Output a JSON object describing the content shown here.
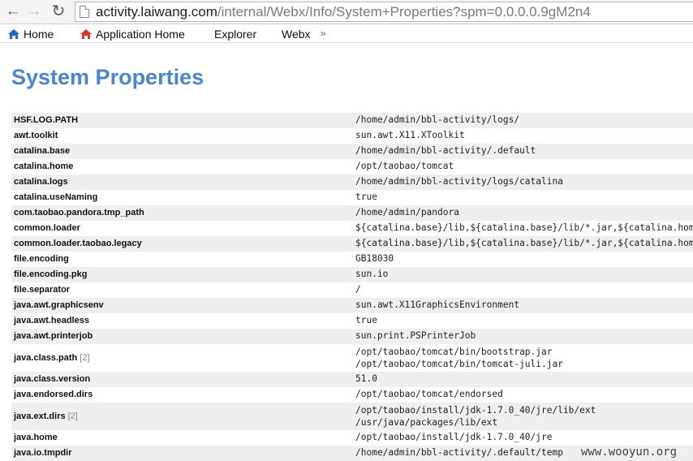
{
  "browser": {
    "url_host": "activity.laiwang.com",
    "url_path": "/internal/Webx/Info/System+Properties?spm=0.0.0.0.9gM2n4"
  },
  "bookmarks": [
    {
      "label": "Home",
      "icon": "home-icon-blue"
    },
    {
      "label": "Application Home",
      "icon": "home-icon-red"
    },
    {
      "label": "Explorer"
    },
    {
      "label": "Webx"
    }
  ],
  "bookmarks_more": "»",
  "page": {
    "title": "System Properties"
  },
  "properties": [
    {
      "key": "HSF.LOG.PATH",
      "values": [
        "/home/admin/bbl-activity/logs/"
      ]
    },
    {
      "key": "awt.toolkit",
      "values": [
        "sun.awt.X11.XToolkit"
      ]
    },
    {
      "key": "catalina.base",
      "values": [
        "/home/admin/bbl-activity/.default"
      ]
    },
    {
      "key": "catalina.home",
      "values": [
        "/opt/taobao/tomcat"
      ]
    },
    {
      "key": "catalina.logs",
      "values": [
        "/home/admin/bbl-activity/logs/catalina"
      ]
    },
    {
      "key": "catalina.useNaming",
      "values": [
        "true"
      ]
    },
    {
      "key": "com.taobao.pandora.tmp_path",
      "values": [
        "/home/admin/pandora"
      ]
    },
    {
      "key": "common.loader",
      "values": [
        "${catalina.base}/lib,${catalina.base}/lib/*.jar,${catalina.home}/lib"
      ]
    },
    {
      "key": "common.loader.taobao.legacy",
      "values": [
        "${catalina.base}/lib,${catalina.base}/lib/*.jar,${catalina.home}/lib"
      ]
    },
    {
      "key": "file.encoding",
      "values": [
        "GB18030"
      ]
    },
    {
      "key": "file.encoding.pkg",
      "values": [
        "sun.io"
      ]
    },
    {
      "key": "file.separator",
      "values": [
        "/"
      ]
    },
    {
      "key": "java.awt.graphicsenv",
      "values": [
        "sun.awt.X11GraphicsEnvironment"
      ]
    },
    {
      "key": "java.awt.headless",
      "values": [
        "true"
      ]
    },
    {
      "key": "java.awt.printerjob",
      "values": [
        "sun.print.PSPrinterJob"
      ]
    },
    {
      "key": "java.class.path",
      "count": "[2]",
      "values": [
        "/opt/taobao/tomcat/bin/bootstrap.jar",
        "/opt/taobao/tomcat/bin/tomcat-juli.jar"
      ]
    },
    {
      "key": "java.class.version",
      "values": [
        "51.0"
      ]
    },
    {
      "key": "java.endorsed.dirs",
      "values": [
        "/opt/taobao/tomcat/endorsed"
      ]
    },
    {
      "key": "java.ext.dirs",
      "count": "[2]",
      "values": [
        "/opt/taobao/install/jdk-1.7.0_40/jre/lib/ext",
        "/usr/java/packages/lib/ext"
      ]
    },
    {
      "key": "java.home",
      "values": [
        "/opt/taobao/install/jdk-1.7.0_40/jre"
      ]
    },
    {
      "key": "java.io.tmpdir",
      "values": [
        "/home/admin/bbl-activity/.default/temp"
      ]
    }
  ],
  "watermark": "www.wooyun.org"
}
